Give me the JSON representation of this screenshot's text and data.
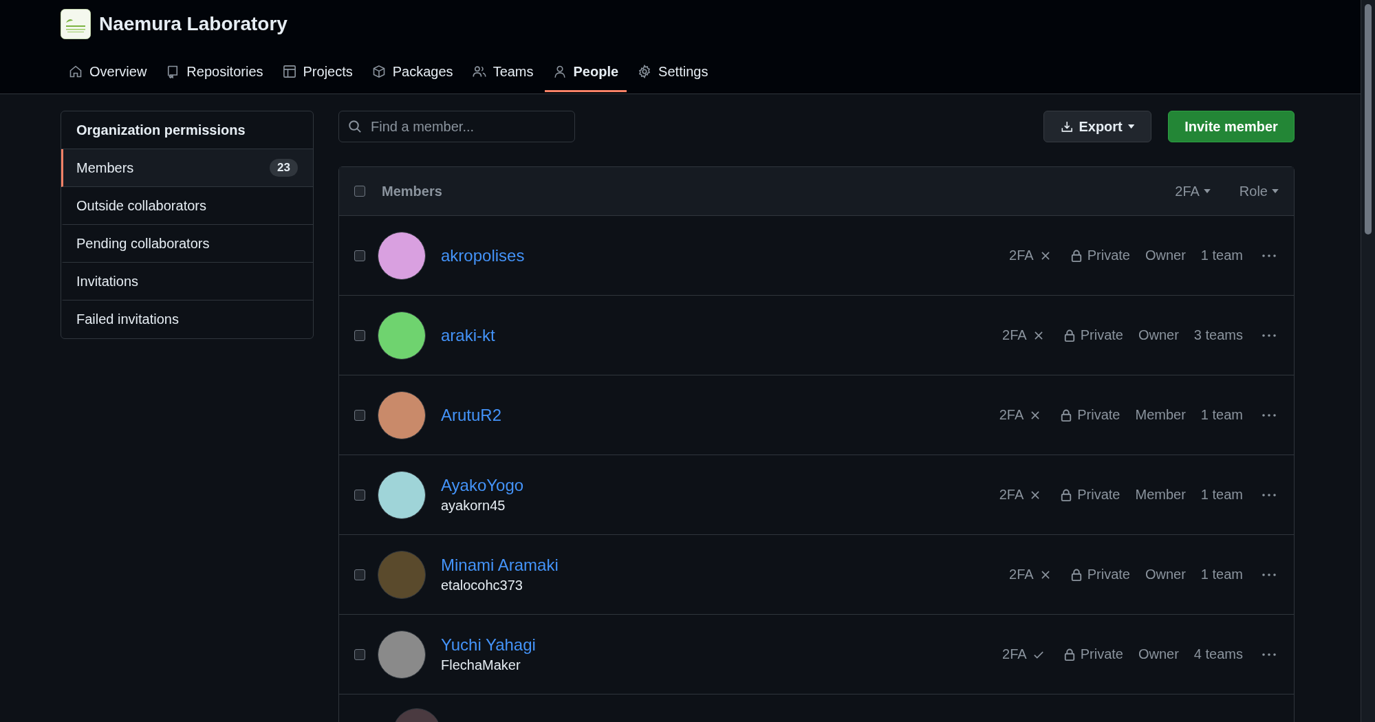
{
  "org": {
    "name": "Naemura Laboratory"
  },
  "tabs": [
    {
      "label": "Overview",
      "selected": false
    },
    {
      "label": "Repositories",
      "selected": false
    },
    {
      "label": "Projects",
      "selected": false
    },
    {
      "label": "Packages",
      "selected": false
    },
    {
      "label": "Teams",
      "selected": false
    },
    {
      "label": "People",
      "selected": true
    },
    {
      "label": "Settings",
      "selected": false
    }
  ],
  "sidebar": {
    "title": "Organization permissions",
    "items": [
      {
        "label": "Members",
        "count": "23",
        "selected": true
      },
      {
        "label": "Outside collaborators",
        "selected": false
      },
      {
        "label": "Pending collaborators",
        "selected": false
      },
      {
        "label": "Invitations",
        "selected": false
      },
      {
        "label": "Failed invitations",
        "selected": false
      }
    ]
  },
  "search": {
    "placeholder": "Find a member..."
  },
  "buttons": {
    "export": "Export",
    "invite": "Invite member"
  },
  "table": {
    "header": {
      "title": "Members",
      "selected": false,
      "filters": [
        "2FA",
        "Role"
      ]
    },
    "rows": [
      {
        "name": "akropolises",
        "selected": false,
        "color": "#d9a0e0",
        "twofa_label": "2FA",
        "twofa": false,
        "visibility": "Private",
        "role": "Owner",
        "teams": "1 team"
      },
      {
        "name": "araki-kt",
        "selected": false,
        "color": "#6fd36f",
        "twofa_label": "2FA",
        "twofa": false,
        "visibility": "Private",
        "role": "Owner",
        "teams": "3 teams"
      },
      {
        "name": "ArutuR2",
        "selected": false,
        "color": "#c98a6a",
        "twofa_label": "2FA",
        "twofa": false,
        "visibility": "Private",
        "role": "Member",
        "teams": "1 team"
      },
      {
        "name": "AyakoYogo",
        "login": "ayakorn45",
        "selected": false,
        "color": "#9fd4d8",
        "twofa_label": "2FA",
        "twofa": false,
        "visibility": "Private",
        "role": "Member",
        "teams": "1 team"
      },
      {
        "name": "Minami Aramaki",
        "login": "etalocohc373",
        "selected": false,
        "color": "#5a4a2c",
        "twofa_label": "2FA",
        "twofa": false,
        "visibility": "Private",
        "role": "Owner",
        "teams": "1 team"
      },
      {
        "name": "Yuchi Yahagi",
        "login": "FlechaMaker",
        "selected": false,
        "color": "#8a8a8a",
        "twofa_label": "2FA",
        "twofa": true,
        "visibility": "Private",
        "role": "Owner",
        "teams": "4 teams"
      }
    ]
  }
}
